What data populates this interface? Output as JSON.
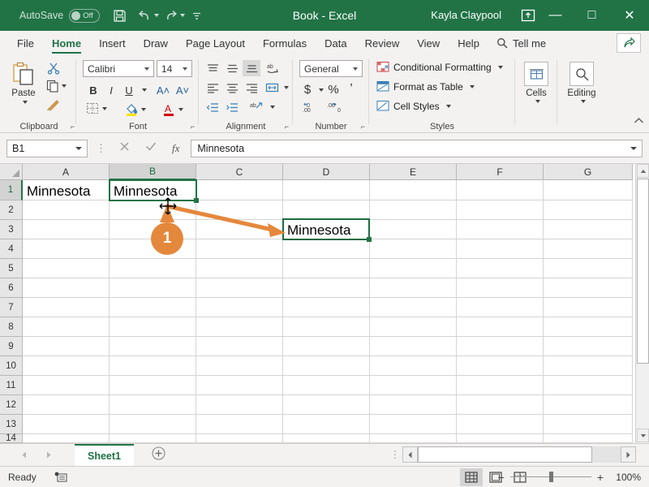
{
  "titlebar": {
    "autosave_label": "AutoSave",
    "autosave_state": "Off",
    "title": "Book  -  Excel",
    "account": "Kayla Claypool",
    "icons": [
      "save-icon",
      "undo-icon",
      "redo-icon",
      "customize-quick-access-icon",
      "ribbon-display-options-icon"
    ],
    "minimize": "—",
    "maximize": "□",
    "close": "✕",
    "bg_color": "#217346"
  },
  "tabs": [
    {
      "label": "File",
      "active": false
    },
    {
      "label": "Home",
      "active": true
    },
    {
      "label": "Insert",
      "active": false
    },
    {
      "label": "Draw",
      "active": false
    },
    {
      "label": "Page Layout",
      "active": false
    },
    {
      "label": "Formulas",
      "active": false
    },
    {
      "label": "Data",
      "active": false
    },
    {
      "label": "Review",
      "active": false
    },
    {
      "label": "View",
      "active": false
    },
    {
      "label": "Help",
      "active": false
    }
  ],
  "tellme": "Tell me",
  "share_label": "share-icon",
  "ribbon": {
    "groups": [
      "Clipboard",
      "Font",
      "Alignment",
      "Number",
      "Styles"
    ],
    "clipboard": {
      "paste_label": "Paste",
      "cut_label": "cut-icon",
      "copy_label": "copy-icon",
      "format_painter_label": "format-painter-icon"
    },
    "font": {
      "font_name": "Calibri",
      "font_size": "14",
      "bold": "B",
      "italic": "I",
      "underline": "U",
      "grow_font": "A˄",
      "shrink_font": "A˅"
    },
    "number": {
      "format": "General",
      "currency": "$",
      "percent": "%",
      "comma": "’"
    },
    "styles": {
      "conditional_formatting": "Conditional Formatting",
      "format_as_table": "Format as Table",
      "cell_styles": "Cell Styles"
    },
    "cells_label": "Cells",
    "editing_label": "Editing"
  },
  "formulabar": {
    "namebox": "B1",
    "cancel": "cancel-icon",
    "enter": "enter-icon",
    "fx": "fx",
    "value": "Minnesota"
  },
  "grid": {
    "columns": [
      "A",
      "B",
      "C",
      "D",
      "E",
      "F",
      "G"
    ],
    "selected_column": "B",
    "rows": [
      "1",
      "2",
      "3",
      "4",
      "5",
      "6",
      "7",
      "8",
      "9",
      "10",
      "11",
      "12",
      "13",
      "14"
    ],
    "selected_row": "1",
    "cells": [
      {
        "ref": "A1",
        "value": "Minnesota"
      },
      {
        "ref": "B1",
        "value": "Minnesota"
      }
    ],
    "selection": "B1",
    "drop_target": {
      "ref": "D3",
      "value": "Minnesota"
    }
  },
  "annotation": {
    "badge_number": "1",
    "color": "#e4883c"
  },
  "sheetbar": {
    "prev": "previous-sheet-icon",
    "next": "next-sheet-icon",
    "sheets": [
      "Sheet1"
    ],
    "active_sheet": "Sheet1",
    "add_sheet": "+"
  },
  "statusbar": {
    "status": "Ready",
    "macro_icon": "record-macro-icon",
    "views": [
      "normal-view",
      "page-layout-view",
      "page-break-preview"
    ],
    "active_view": "normal-view",
    "zoom_out": "−",
    "zoom_in": "+",
    "zoom_level": "100%"
  }
}
